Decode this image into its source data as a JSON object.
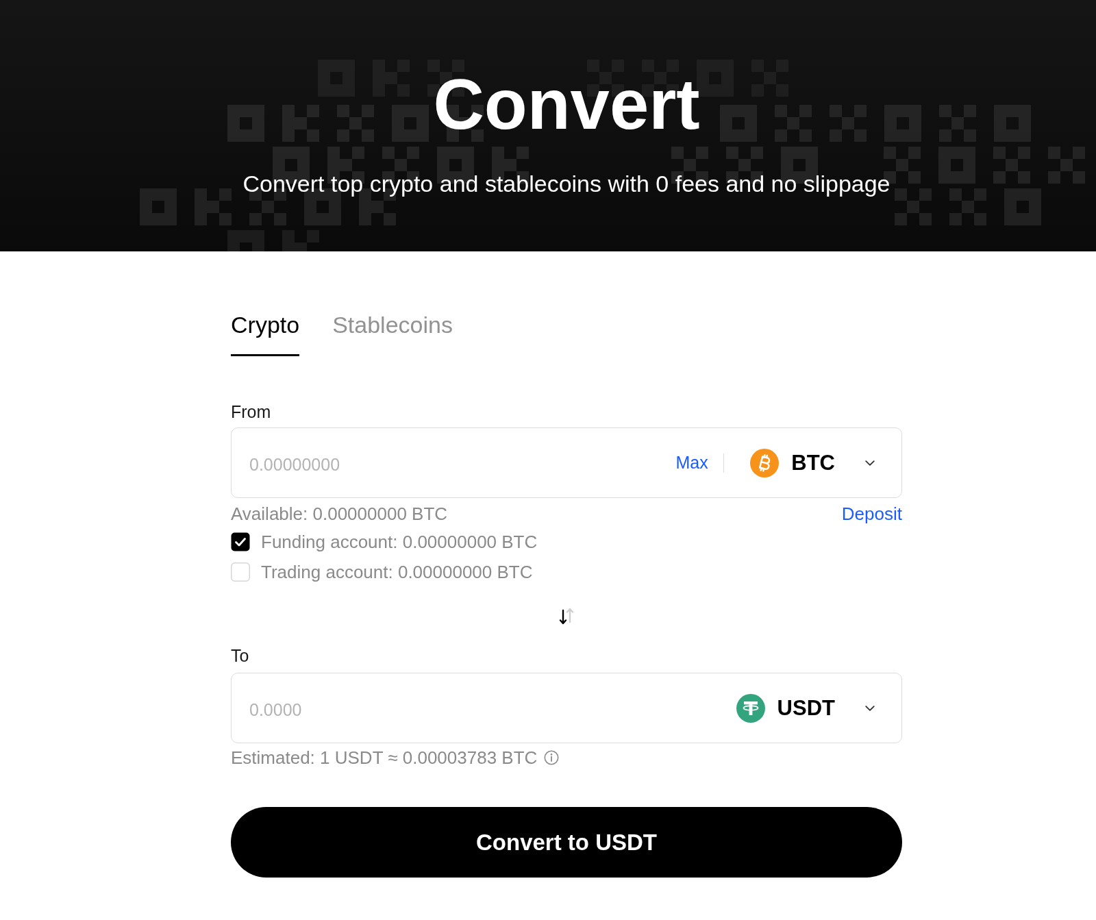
{
  "header": {
    "title": "Convert",
    "subtitle": "Convert top crypto and stablecoins with 0 fees and no slippage"
  },
  "tabs": [
    {
      "label": "Crypto",
      "selected": true
    },
    {
      "label": "Stablecoins",
      "selected": false
    }
  ],
  "from": {
    "label": "From",
    "placeholder": "0.00000000",
    "max": "Max",
    "currency": "BTC",
    "available": "Available: 0.00000000 BTC",
    "deposit": "Deposit"
  },
  "accounts": [
    {
      "label": "Funding account: 0.00000000 BTC",
      "checked": true
    },
    {
      "label": "Trading account: 0.00000000 BTC",
      "checked": false
    }
  ],
  "to": {
    "label": "To",
    "placeholder": "0.0000",
    "currency": "USDT",
    "estimate": "Estimated: 1 USDT ≈ 0.00003783 BTC"
  },
  "submit": "Convert to USDT"
}
